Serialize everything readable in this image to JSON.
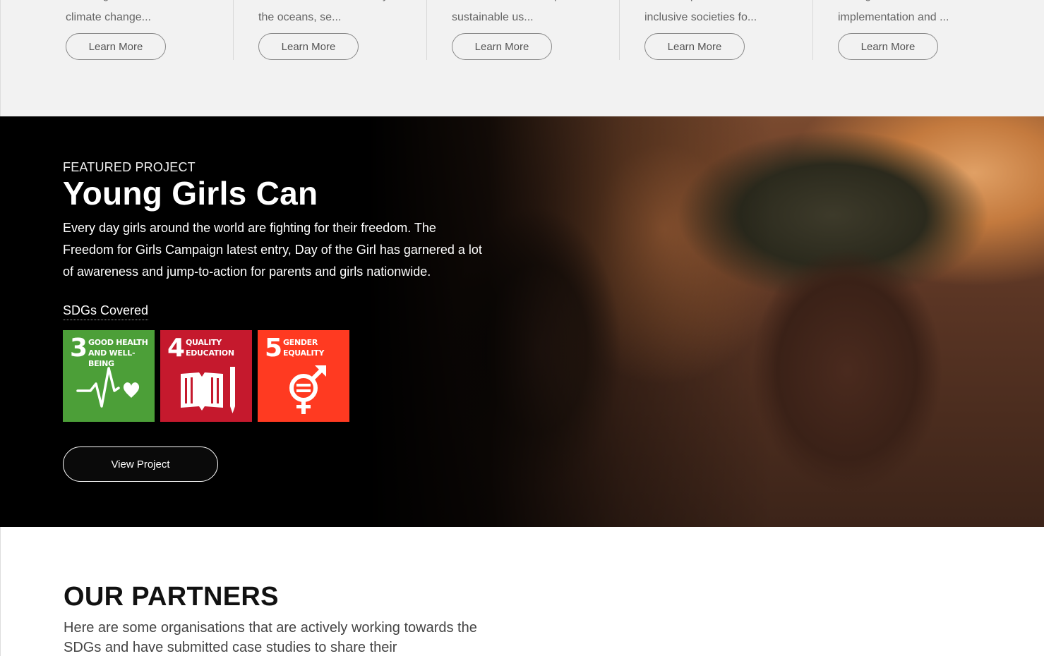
{
  "sdg_cards": [
    {
      "excerpt_line1": "Take urgent action to combat",
      "excerpt_line2": "climate change...",
      "button_label": "Learn More"
    },
    {
      "excerpt_line1": "Conserve and sustainably use",
      "excerpt_line2": "the oceans, se...",
      "button_label": "Learn More"
    },
    {
      "excerpt_line1": "Protect, restore and promote",
      "excerpt_line2": "sustainable us...",
      "button_label": "Learn More"
    },
    {
      "excerpt_line1": "Promote peaceful and",
      "excerpt_line2": "inclusive societies fo...",
      "button_label": "Learn More"
    },
    {
      "excerpt_line1": "Strengthen the means of",
      "excerpt_line2": "implementation and ...",
      "button_label": "Learn More"
    }
  ],
  "featured": {
    "eyebrow": "FEATURED PROJECT",
    "title": "Young Girls Can",
    "description": "Every day girls around the world are fighting for their freedom. The Freedom for Girls Campaign latest entry, Day of the Girl has garnered a lot of awareness and jump-to-action for parents and girls nationwide.",
    "sdgs_label": "SDGs Covered",
    "goals": [
      {
        "number": "3",
        "name_line1": "GOOD HEALTH",
        "name_line2": "AND WELL-BEING",
        "color": "#4c9f38",
        "icon": "heartbeat-icon"
      },
      {
        "number": "4",
        "name_line1": "QUALITY",
        "name_line2": "EDUCATION",
        "color": "#c5192d",
        "icon": "book-pencil-icon"
      },
      {
        "number": "5",
        "name_line1": "GENDER",
        "name_line2": "EQUALITY",
        "color": "#ff3a21",
        "icon": "gender-equality-icon"
      }
    ],
    "button_label": "View Project"
  },
  "partners": {
    "title": "OUR PARTNERS",
    "description": "Here are some organisations that are actively working towards the SDGs and have submitted case studies to share their"
  }
}
